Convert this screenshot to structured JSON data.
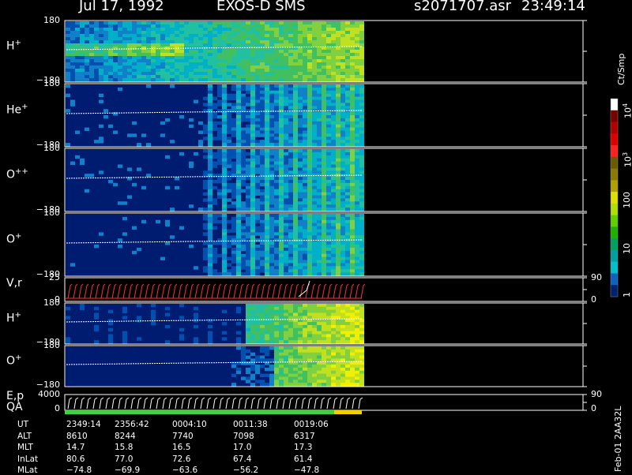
{
  "header": {
    "date": "Jul 17, 1992",
    "instrument": "EXOS-D SMS",
    "file": "s2071707.asr",
    "time": "23:49:14"
  },
  "panels": [
    {
      "label": "H",
      "sup": "+",
      "top_tick": "180",
      "bottom_tick": "−180"
    },
    {
      "label": "He",
      "sup": "+",
      "top_tick": "180",
      "bottom_tick": "−180"
    },
    {
      "label": "O",
      "sup": "++",
      "top_tick": "180",
      "bottom_tick": "−180"
    },
    {
      "label": "O",
      "sup": "+",
      "top_tick": "180",
      "bottom_tick": "−180"
    },
    {
      "label": "V,r",
      "sup": "",
      "top_tick": "25",
      "bottom_tick": "0",
      "right_top": "90",
      "right_bottom": "0"
    },
    {
      "label": "H",
      "sup": "+",
      "top_tick": "180",
      "bottom_tick": "−180"
    },
    {
      "label": "O",
      "sup": "+",
      "top_tick": "180",
      "bottom_tick": "−180"
    },
    {
      "label": "E,p",
      "sup": "",
      "label2": "QA",
      "top_tick": "4000",
      "bottom_tick": "0",
      "right_top": "90",
      "right_bottom": "0"
    }
  ],
  "colorbar": {
    "unit": "Ct/Smp",
    "labels": [
      "10",
      "10",
      "100",
      "10",
      "1"
    ],
    "exponents": [
      "4",
      "3",
      "",
      "",
      ""
    ],
    "colors": [
      "#ffffff",
      "#7a0000",
      "#b00000",
      "#e00000",
      "#ff2020",
      "#6a5a00",
      "#8a7a00",
      "#b0a000",
      "#e0e000",
      "#b0e000",
      "#60d000",
      "#20b000",
      "#00a060",
      "#00a0a0",
      "#00c0d0",
      "#1060c0",
      "#002070"
    ]
  },
  "footer_id": "Feb-01 2AA32L",
  "table": {
    "rows": [
      {
        "name": "UT",
        "values": [
          "2349:14",
          "2356:42",
          "0004:10",
          "0011:38",
          "0019:06"
        ]
      },
      {
        "name": "ALT",
        "values": [
          "8610",
          "8244",
          "7740",
          "7098",
          "6317"
        ]
      },
      {
        "name": "MLT",
        "values": [
          "14.7",
          "15.8",
          "16.5",
          "17.0",
          "17.3"
        ]
      },
      {
        "name": "InLat",
        "values": [
          "80.6",
          "77.0",
          "72.6",
          "67.4",
          "61.4"
        ]
      },
      {
        "name": "MLat",
        "values": [
          "−74.8",
          "−69.9",
          "−63.6",
          "−56.2",
          "−47.8"
        ]
      }
    ]
  },
  "chart_data": {
    "type": "heatmap",
    "title": "EXOS-D SMS",
    "x": [
      "2349:14",
      "2356:42",
      "0004:10",
      "0011:38",
      "0019:06"
    ],
    "panels": [
      "H+",
      "He+",
      "O++",
      "O+",
      "V,r",
      "H+",
      "O+",
      "E,p QA"
    ],
    "ylim_angle": [
      -180,
      180
    ],
    "vr_ylim": [
      0,
      25
    ],
    "ep_ylim": [
      0,
      4000
    ],
    "colorbar_range": [
      1,
      10000
    ],
    "colorbar_scale": "log"
  }
}
